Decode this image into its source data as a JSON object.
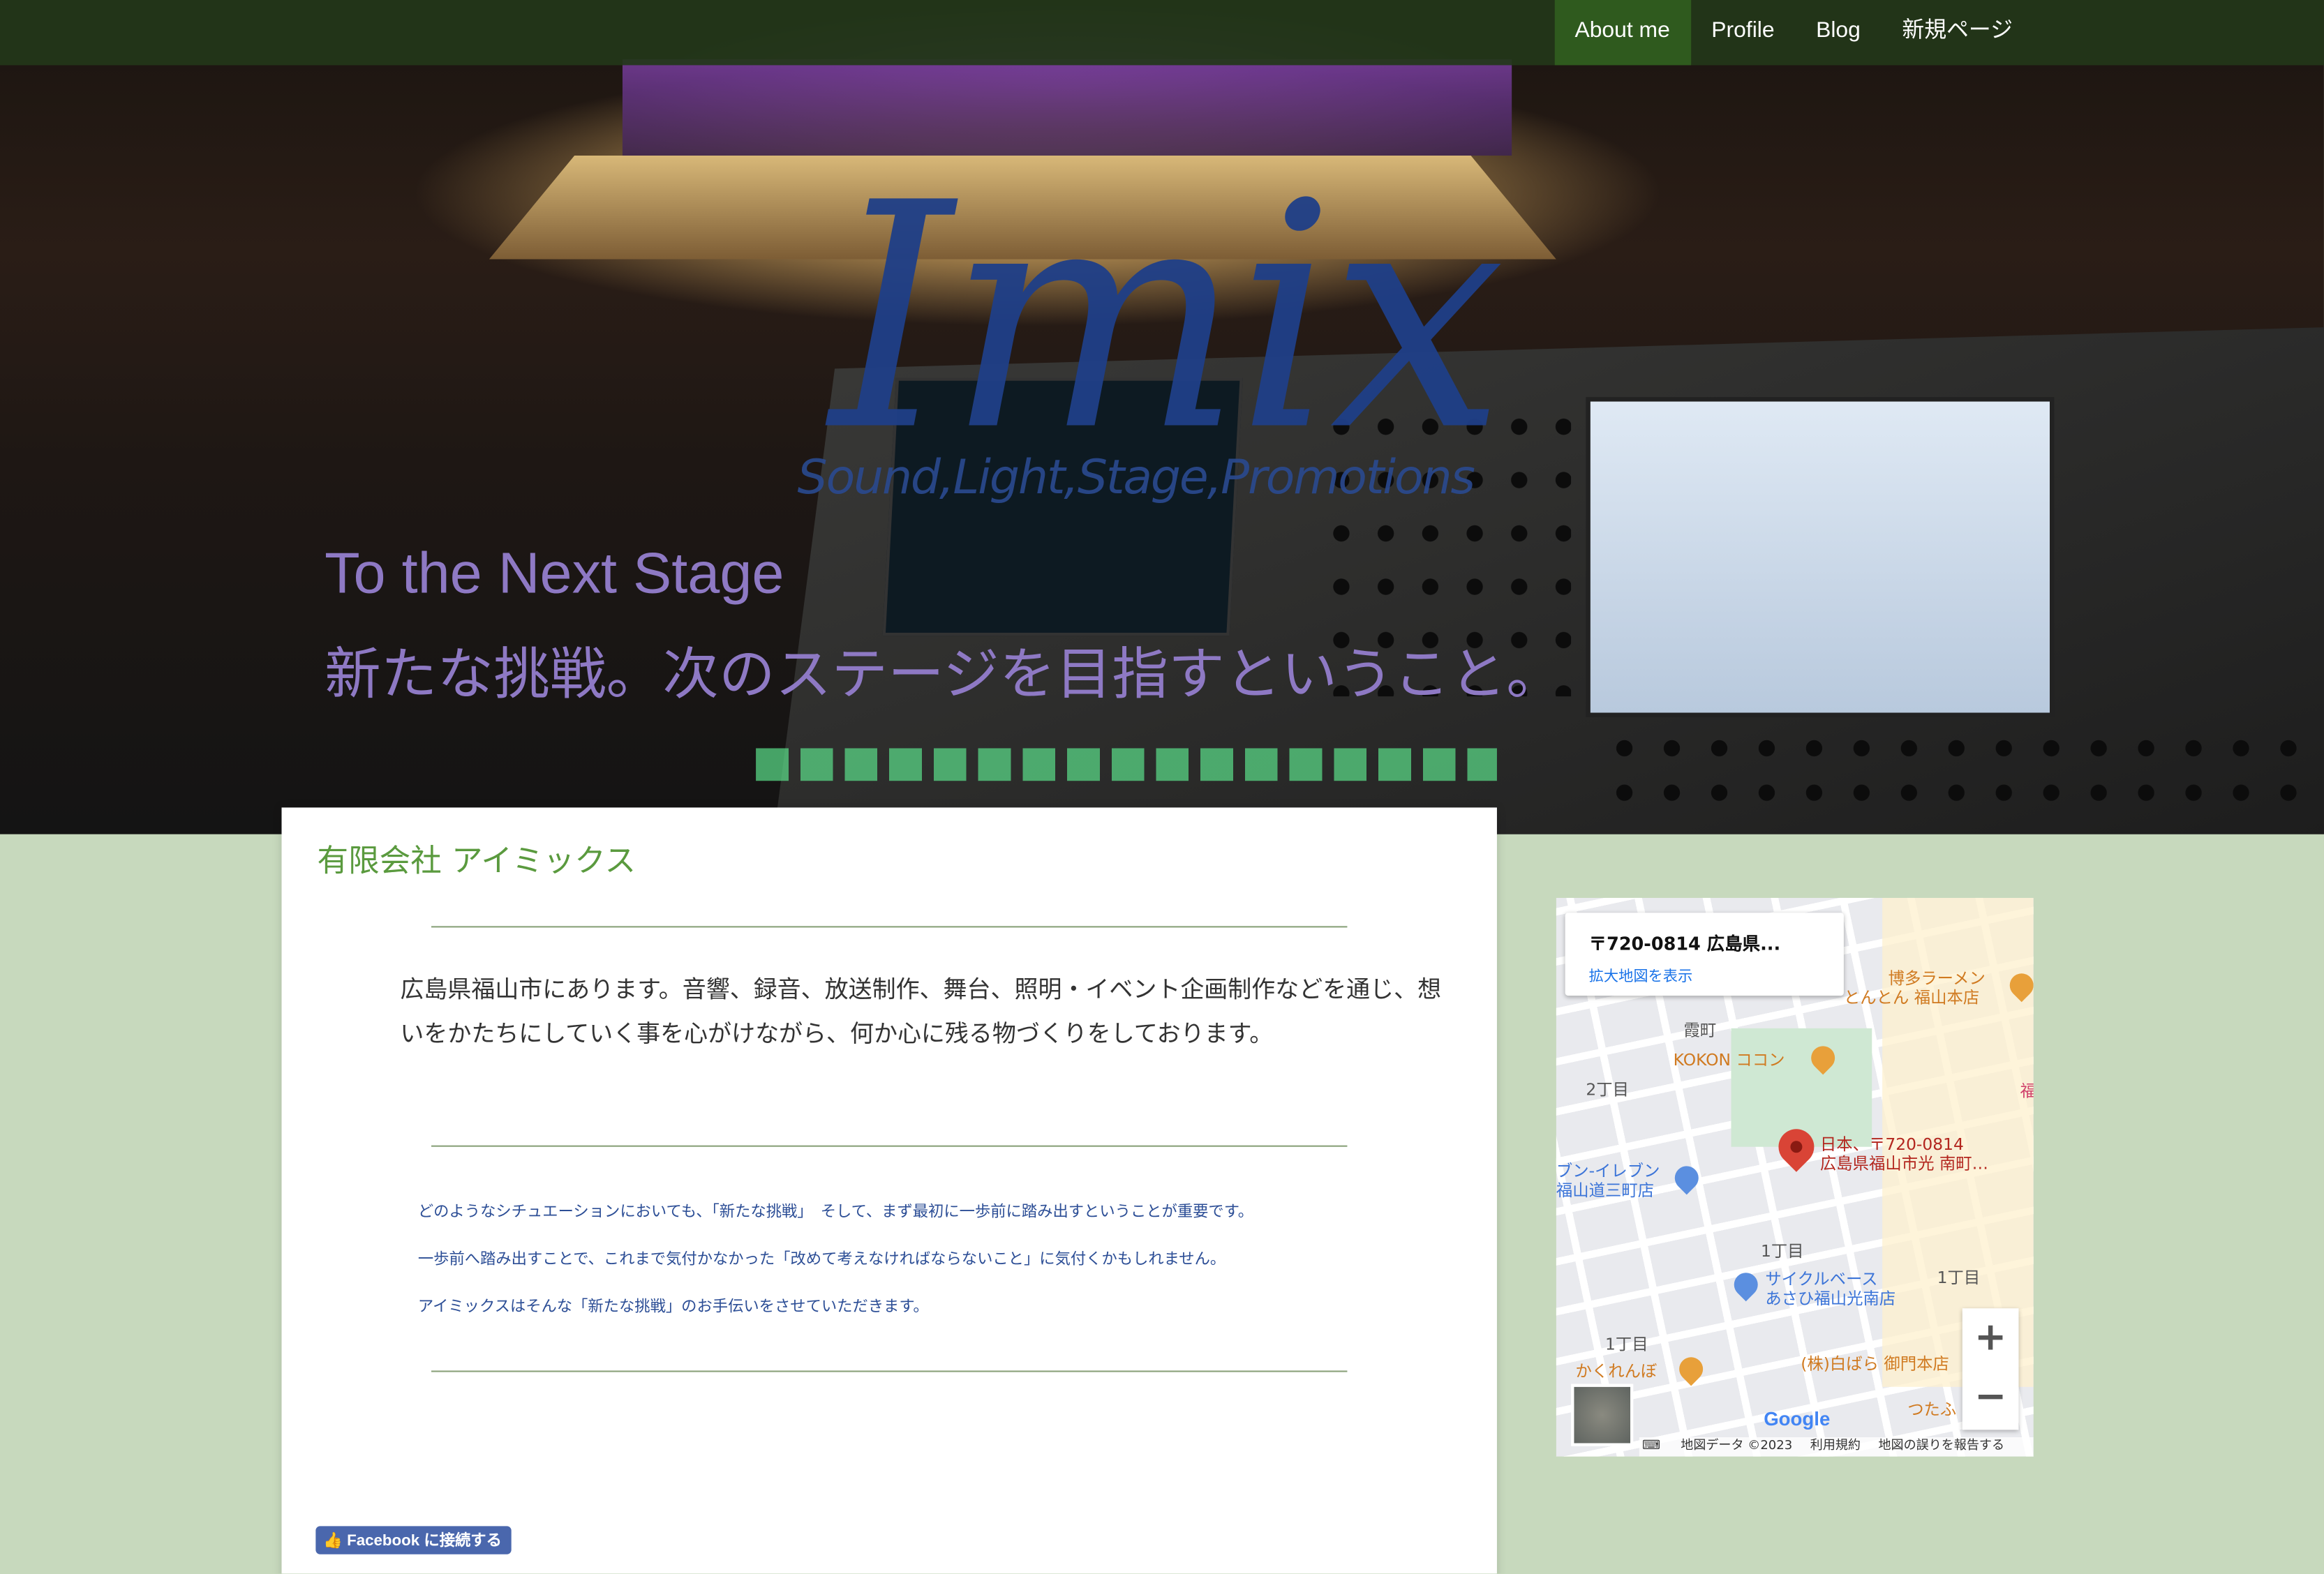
{
  "nav": {
    "items": [
      {
        "label": "About me",
        "active": true
      },
      {
        "label": "Profile"
      },
      {
        "label": "Blog"
      },
      {
        "label": "新規ページ"
      }
    ]
  },
  "hero": {
    "logo": "Imix",
    "logo_tagline": "Sound,Light,Stage,Promotions",
    "heading_en": "To the Next Stage",
    "heading_jp": "新たな挑戦。次のステージを目指すということ。"
  },
  "main": {
    "title": "有限会社 アイミックス",
    "intro": "広島県福山市にあります。音響、録音、放送制作、舞台、照明・イベント企画制作などを通じ、想いをかたちにしていく事を心がけながら、何か心に残る物づくりをしております。",
    "paragraphs": [
      "どのようなシチュエーションにおいても、「新たな挑戦」　そして、まず最初に一歩前に踏み出すということが重要です。",
      "一歩前へ踏み出すことで、これまで気付かなかった「改めて考えなければならないこと」に気付くかもしれません。",
      "アイミックスはそんな「新たな挑戦」のお手伝いをさせていただきます。"
    ],
    "facebook_button": "Facebook に接続する"
  },
  "map": {
    "info_title": "〒720-0814 広島県...",
    "info_link": "拡大地図を表示",
    "labels": {
      "hakata": "博多ラーメン",
      "tonton": "とんとん 福山本店",
      "kasumi": "霞町",
      "kokon": "KOKON ココン",
      "chome2": "2丁目",
      "marker1": "日本、〒720-0814",
      "marker2": "広島県福山市光 南町…",
      "seven1": "ブン-イレブン",
      "seven2": "福山道三町店",
      "chome1a": "1丁目",
      "cycle1": "サイクルベース",
      "cycle2": "あさひ福山光南店",
      "chome1b": "1丁目",
      "chome1c": "1丁目",
      "kakurenbo": "かくれんぼ",
      "shirobara": "(株)白ばら 御門本店",
      "tsuta": "つたふ",
      "fuku": "福"
    },
    "zoom_in": "+",
    "zoom_out": "−",
    "google": "Google",
    "attribution": [
      "地図データ ©2023",
      "利用規約",
      "地図の誤りを報告する"
    ],
    "colors": {
      "marker": "#d94436",
      "poi_orange": "#e8a03a",
      "poi_blue": "#5b8fe0"
    }
  }
}
